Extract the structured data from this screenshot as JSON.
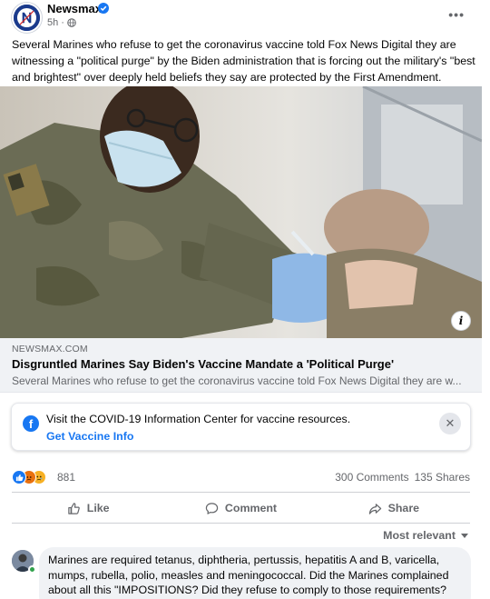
{
  "post": {
    "page_name": "Newsmax",
    "time": "5h",
    "meta_separator": "·",
    "more_label": "•••",
    "body": "Several Marines who refuse to get the coronavirus vaccine told Fox News Digital they are witnessing a \"political purge\" by the Biden administration that is forcing out the military's \"best and brightest\" over deeply held beliefs they say are protected by the First Amendment."
  },
  "link_preview": {
    "domain": "NEWSMAX.COM",
    "title": "Disgruntled Marines Say Biden's Vaccine Mandate a 'Political Purge'",
    "description": "Several Marines who refuse to get the coronavirus vaccine told Fox News Digital they are w...",
    "info_label": "i"
  },
  "covid_notice": {
    "text": "Visit the COVID-19 Information Center for vaccine resources.",
    "link": "Get Vaccine Info",
    "close_label": "✕",
    "icon_letter": "f"
  },
  "stats": {
    "reaction_count": "881",
    "comments": "300 Comments",
    "shares": "135 Shares",
    "reactions": [
      "like",
      "angry",
      "sad"
    ]
  },
  "actions": {
    "like": "Like",
    "comment": "Comment",
    "share": "Share"
  },
  "comments_section": {
    "sort_label": "Most relevant",
    "first_comment": "Marines are required tetanus, diphtheria, pertussis, hepatitis A and B, varicella, mumps, rubella, polio, measles and meningococcal. Did the Marines complained about all this \"IMPOSITIONS? Did they refuse to comply to those requirements?"
  },
  "colors": {
    "accent": "#1877f2",
    "secondary_text": "#65676b",
    "like_blue": "#1877f2",
    "angry_orange": "#e9710f",
    "sad_yellow": "#f7b125",
    "online_green": "#31a24c"
  },
  "icons": {
    "verified": "verified-badge-icon",
    "globe": "globe-icon",
    "like": "thumbs-up-icon",
    "comment": "speech-bubble-icon",
    "share": "share-arrow-icon",
    "close": "close-icon",
    "info": "info-icon"
  }
}
